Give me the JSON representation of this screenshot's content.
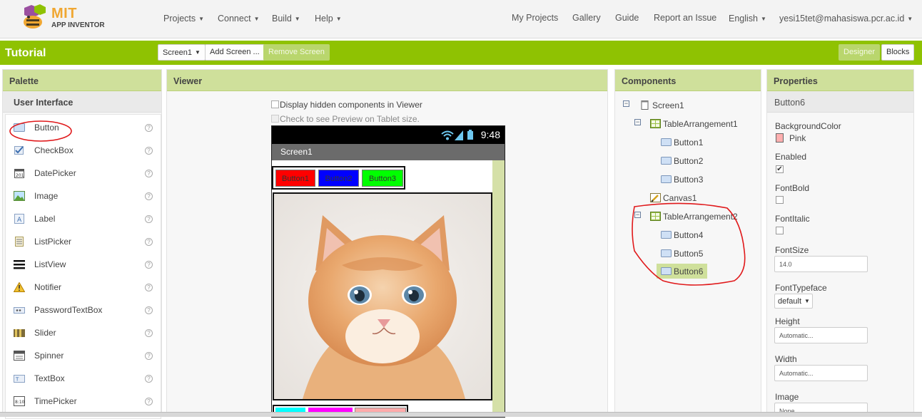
{
  "app": {
    "brand_top": "MIT",
    "brand_bottom": "APP INVENTOR"
  },
  "nav": {
    "left": [
      "Projects",
      "Connect",
      "Build",
      "Help"
    ],
    "right": [
      "My Projects",
      "Gallery",
      "Guide",
      "Report an Issue",
      "English",
      "yesi15tet@mahasiswa.pcr.ac.id"
    ]
  },
  "project": {
    "title": "Tutorial",
    "screen_select": "Screen1",
    "add_screen": "Add Screen ...",
    "remove_screen": "Remove Screen",
    "designer": "Designer",
    "blocks": "Blocks"
  },
  "palette": {
    "title": "Palette",
    "category": "User Interface",
    "items": [
      "Button",
      "CheckBox",
      "DatePicker",
      "Image",
      "Label",
      "ListPicker",
      "ListView",
      "Notifier",
      "PasswordTextBox",
      "Slider",
      "Spinner",
      "TextBox",
      "TimePicker"
    ],
    "help_glyph": "?"
  },
  "viewer": {
    "title": "Viewer",
    "hidden_components": "Display hidden components in Viewer",
    "tablet_preview": "Check to see Preview on Tablet size.",
    "phone": {
      "time": "9:48",
      "screen_title": "Screen1",
      "buttons": [
        {
          "text": "Button1",
          "color": "#ff0000"
        },
        {
          "text": "Button2",
          "color": "#0000ff"
        },
        {
          "text": "Button3",
          "color": "#00ff00"
        }
      ],
      "row2_colors": [
        "#00ffff",
        "#ff00ff",
        "#ffaaaa"
      ]
    }
  },
  "components": {
    "title": "Components",
    "tree": [
      {
        "label": "Screen1",
        "toggle": "⊟"
      },
      {
        "label": "TableArrangement1",
        "toggle": "⊟"
      },
      {
        "label": "Button1"
      },
      {
        "label": "Button2"
      },
      {
        "label": "Button3"
      },
      {
        "label": "Canvas1"
      },
      {
        "label": "TableArrangement2",
        "toggle": "⊟"
      },
      {
        "label": "Button4"
      },
      {
        "label": "Button5"
      },
      {
        "label": "Button6"
      }
    ],
    "selected": "Button6"
  },
  "properties": {
    "title": "Properties",
    "component": "Button6",
    "background_color_label": "BackgroundColor",
    "background_color_value": "Pink",
    "background_color_swatch": "#ffafaf",
    "enabled_label": "Enabled",
    "enabled_checked": "✔",
    "fontbold_label": "FontBold",
    "fontitalic_label": "FontItalic",
    "fontsize_label": "FontSize",
    "fontsize_value": "14.0",
    "fonttypeface_label": "FontTypeface",
    "fonttypeface_value": "default",
    "height_label": "Height",
    "height_value": "Automatic...",
    "width_label": "Width",
    "width_value": "Automatic...",
    "image_label": "Image",
    "image_value": "None..."
  },
  "colors": {
    "accent": "#8fc202",
    "panel_header": "#cfe09b",
    "annotation": "#e0191b"
  }
}
